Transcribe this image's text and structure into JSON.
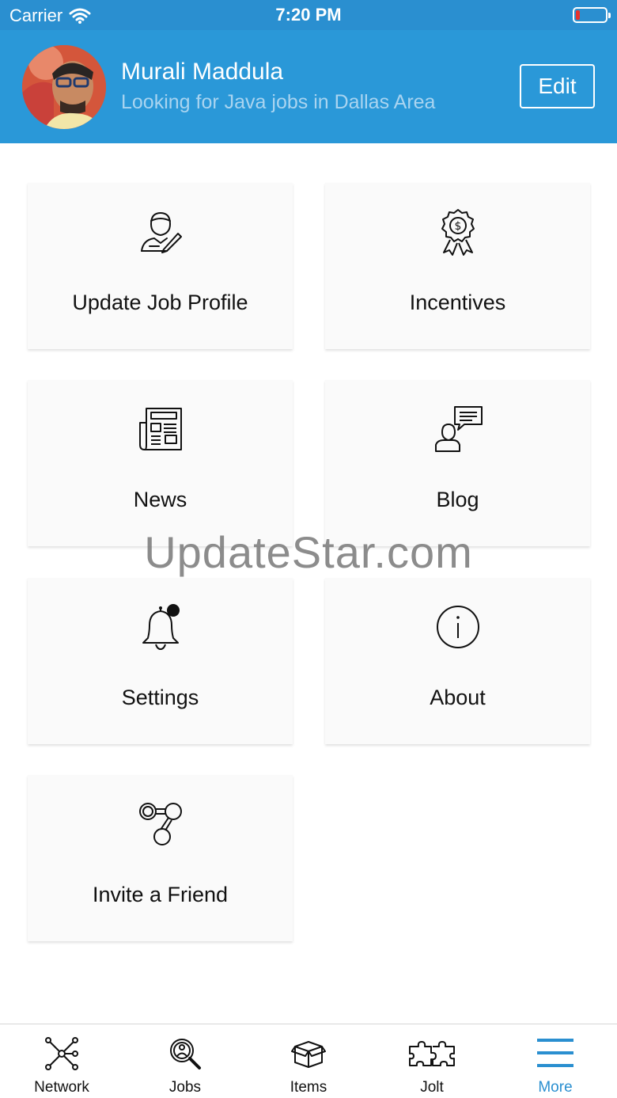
{
  "status_bar": {
    "carrier": "Carrier",
    "time": "7:20 PM",
    "battery_level_fraction": 0.15,
    "battery_color": "#e8322c"
  },
  "profile": {
    "name": "Murali Maddula",
    "tagline": "Looking for Java jobs in Dallas Area",
    "edit_label": "Edit",
    "header_color": "#2a98d8"
  },
  "menu": {
    "tiles": [
      {
        "label": "Update Job Profile",
        "icon": "user-edit-icon"
      },
      {
        "label": "Incentives",
        "icon": "award-badge-icon"
      },
      {
        "label": "News",
        "icon": "newspaper-icon"
      },
      {
        "label": "Blog",
        "icon": "speech-bubble-user-icon"
      },
      {
        "label": "Settings",
        "icon": "bell-icon"
      },
      {
        "label": "About",
        "icon": "info-circle-icon"
      },
      {
        "label": "Invite a Friend",
        "icon": "share-nodes-icon"
      }
    ]
  },
  "watermark": "UpdateStar.com",
  "tab_bar": {
    "active_color": "#2a8fd0",
    "tabs": [
      {
        "label": "Network",
        "icon": "network-icon",
        "active": false
      },
      {
        "label": "Jobs",
        "icon": "job-search-icon",
        "active": false
      },
      {
        "label": "Items",
        "icon": "box-icon",
        "active": false
      },
      {
        "label": "Jolt",
        "icon": "puzzle-icon",
        "active": false
      },
      {
        "label": "More",
        "icon": "hamburger-menu-icon",
        "active": true
      }
    ]
  }
}
